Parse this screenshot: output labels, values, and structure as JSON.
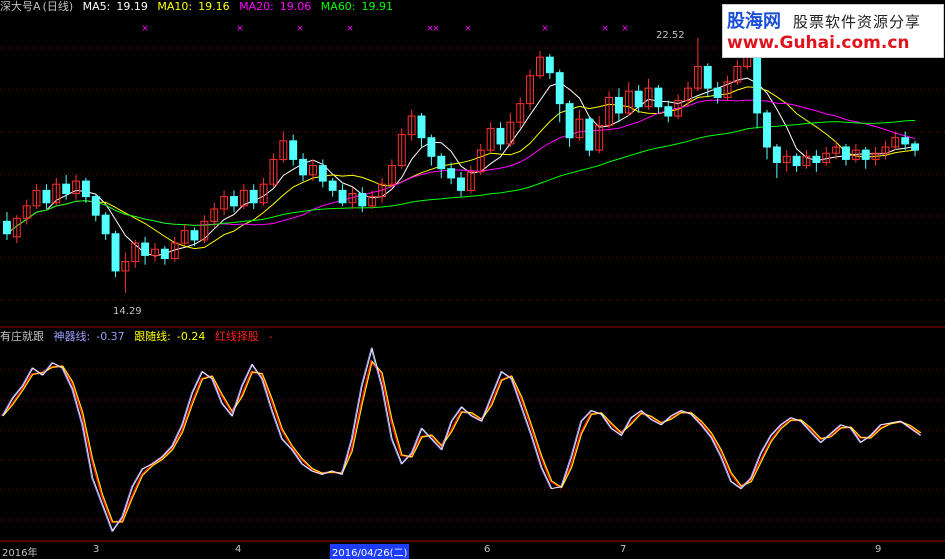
{
  "header": {
    "stock_name": "深大号A",
    "period": "(日线)",
    "ma5": {
      "label": "MA5:",
      "value": "19.19",
      "color": "#ffffff"
    },
    "ma10": {
      "label": "MA10:",
      "value": "19.16",
      "color": "#ffff00"
    },
    "ma20": {
      "label": "MA20:",
      "value": "19.06",
      "color": "#ff00ff"
    },
    "ma60": {
      "label": "MA60:",
      "value": "19.91",
      "color": "#00ff00"
    }
  },
  "indicator": {
    "name": "有庄就跟",
    "line1": {
      "label": "神器线:",
      "value": "-0.37",
      "color": "#9b9bff"
    },
    "line2": {
      "label": "跟随线:",
      "value": "-0.24",
      "color": "#ffff00"
    },
    "line3": {
      "label": "红线择股",
      "value": "-",
      "color": "#ff2020"
    }
  },
  "annotations": {
    "high": "22.52",
    "low": "14.29"
  },
  "logo": {
    "title": "股海网",
    "subtitle": "股票软件资源分享",
    "url": "www.Guhai.com.cn"
  },
  "axis": {
    "left": "2016年",
    "date_highlight": "2016/04/26(二)",
    "ticks": [
      "3",
      "4",
      "6",
      "7",
      "9"
    ]
  },
  "colors": {
    "up": "#ff3030",
    "down": "#54ffff",
    "grid": "#800000",
    "bg": "#000000"
  },
  "chart_data": {
    "type": "candlestick",
    "price_range": [
      14.29,
      22.52
    ],
    "series": [
      {
        "name": "MA5",
        "color": "#ffffff"
      },
      {
        "name": "MA10",
        "color": "#ffff00"
      },
      {
        "name": "MA20",
        "color": "#ff00ff"
      },
      {
        "name": "MA60",
        "color": "#00ff00"
      }
    ],
    "candles": [
      [
        16.6,
        16.2,
        16.9,
        16.0
      ],
      [
        16.1,
        16.7,
        16.8,
        15.9
      ],
      [
        16.7,
        17.1,
        17.3,
        16.5
      ],
      [
        17.1,
        17.6,
        17.8,
        17.0
      ],
      [
        17.6,
        17.2,
        17.8,
        17.0
      ],
      [
        17.2,
        17.8,
        18.0,
        17.1
      ],
      [
        17.8,
        17.5,
        18.1,
        17.3
      ],
      [
        17.5,
        17.9,
        18.1,
        17.3
      ],
      [
        17.9,
        17.4,
        18.0,
        17.2
      ],
      [
        17.4,
        16.8,
        17.5,
        16.6
      ],
      [
        16.8,
        16.2,
        16.9,
        16.0
      ],
      [
        16.2,
        15.0,
        16.3,
        14.8
      ],
      [
        15.0,
        15.3,
        15.6,
        14.29
      ],
      [
        15.3,
        15.9,
        16.0,
        15.1
      ],
      [
        15.9,
        15.5,
        16.1,
        15.2
      ],
      [
        15.5,
        15.7,
        15.9,
        15.3
      ],
      [
        15.7,
        15.4,
        15.8,
        15.2
      ],
      [
        15.4,
        15.9,
        16.1,
        15.3
      ],
      [
        15.9,
        16.3,
        16.5,
        15.8
      ],
      [
        16.3,
        16.0,
        16.4,
        15.8
      ],
      [
        16.0,
        16.6,
        16.8,
        15.9
      ],
      [
        16.6,
        17.0,
        17.2,
        16.4
      ],
      [
        17.0,
        17.4,
        17.6,
        16.8
      ],
      [
        17.4,
        17.1,
        17.6,
        16.9
      ],
      [
        17.1,
        17.6,
        17.8,
        17.0
      ],
      [
        17.6,
        17.2,
        17.8,
        17.0
      ],
      [
        17.2,
        17.8,
        18.0,
        17.1
      ],
      [
        17.8,
        18.6,
        18.8,
        17.7
      ],
      [
        18.6,
        19.2,
        19.5,
        18.5
      ],
      [
        19.2,
        18.6,
        19.4,
        18.4
      ],
      [
        18.6,
        18.1,
        18.8,
        17.9
      ],
      [
        18.1,
        18.4,
        18.6,
        17.9
      ],
      [
        18.4,
        17.9,
        18.6,
        17.7
      ],
      [
        17.9,
        17.6,
        18.0,
        17.4
      ],
      [
        17.6,
        17.2,
        17.8,
        17.1
      ],
      [
        17.2,
        17.5,
        17.7,
        17.0
      ],
      [
        17.5,
        17.1,
        17.7,
        16.9
      ],
      [
        17.1,
        17.4,
        17.6,
        17.0
      ],
      [
        17.4,
        17.8,
        18.0,
        17.2
      ],
      [
        17.8,
        18.4,
        18.6,
        17.7
      ],
      [
        18.4,
        19.4,
        19.6,
        18.3
      ],
      [
        19.4,
        20.0,
        20.2,
        19.2
      ],
      [
        20.0,
        19.3,
        20.1,
        19.0
      ],
      [
        19.3,
        18.7,
        19.4,
        18.4
      ],
      [
        18.7,
        18.3,
        18.8,
        18.0
      ],
      [
        18.3,
        18.0,
        18.5,
        17.8
      ],
      [
        18.0,
        17.6,
        18.2,
        17.4
      ],
      [
        17.6,
        18.2,
        18.4,
        17.5
      ],
      [
        18.2,
        18.9,
        19.1,
        18.1
      ],
      [
        18.9,
        19.6,
        19.8,
        18.8
      ],
      [
        19.6,
        19.1,
        19.8,
        18.9
      ],
      [
        19.1,
        19.8,
        20.1,
        19.0
      ],
      [
        19.8,
        20.4,
        20.6,
        19.6
      ],
      [
        20.4,
        21.3,
        21.5,
        20.2
      ],
      [
        21.3,
        21.9,
        22.1,
        21.2
      ],
      [
        21.9,
        21.4,
        22.0,
        21.2
      ],
      [
        21.4,
        20.4,
        21.5,
        19.8
      ],
      [
        20.4,
        19.3,
        20.5,
        19.0
      ],
      [
        19.3,
        19.9,
        20.2,
        19.2
      ],
      [
        19.9,
        18.9,
        20.0,
        18.7
      ],
      [
        18.9,
        19.7,
        20.0,
        18.8
      ],
      [
        19.7,
        20.6,
        20.8,
        19.6
      ],
      [
        20.6,
        20.1,
        20.9,
        19.8
      ],
      [
        20.1,
        20.8,
        21.1,
        20.0
      ],
      [
        20.8,
        20.3,
        21.0,
        20.1
      ],
      [
        20.3,
        20.9,
        21.2,
        20.2
      ],
      [
        20.9,
        20.3,
        21.0,
        20.1
      ],
      [
        20.3,
        20.0,
        20.5,
        19.8
      ],
      [
        20.0,
        20.5,
        20.7,
        19.9
      ],
      [
        20.5,
        20.9,
        21.1,
        20.3
      ],
      [
        20.9,
        21.6,
        22.52,
        20.8
      ],
      [
        21.6,
        20.9,
        21.7,
        20.6
      ],
      [
        20.9,
        20.6,
        21.1,
        20.4
      ],
      [
        20.6,
        21.1,
        21.3,
        20.5
      ],
      [
        21.1,
        21.6,
        21.8,
        21.0
      ],
      [
        21.6,
        21.9,
        22.1,
        21.5
      ],
      [
        21.9,
        20.1,
        22.0,
        19.6
      ],
      [
        20.1,
        19.0,
        20.2,
        18.6
      ],
      [
        19.0,
        18.5,
        19.1,
        18.0
      ],
      [
        18.5,
        18.7,
        18.9,
        18.2
      ],
      [
        18.7,
        18.4,
        18.8,
        18.2
      ],
      [
        18.4,
        18.7,
        18.9,
        18.3
      ],
      [
        18.7,
        18.5,
        18.9,
        18.2
      ],
      [
        18.5,
        18.8,
        19.0,
        18.4
      ],
      [
        18.8,
        19.0,
        19.2,
        18.6
      ],
      [
        19.0,
        18.6,
        19.1,
        18.4
      ],
      [
        18.6,
        18.9,
        19.1,
        18.5
      ],
      [
        18.9,
        18.6,
        19.0,
        18.3
      ],
      [
        18.6,
        18.8,
        19.0,
        18.4
      ],
      [
        18.8,
        19.0,
        19.2,
        18.6
      ],
      [
        19.0,
        19.3,
        19.5,
        18.9
      ],
      [
        19.3,
        19.1,
        19.5,
        18.9
      ],
      [
        19.1,
        18.9,
        19.2,
        18.7
      ]
    ],
    "indicator_points": [
      0.45,
      0.55,
      0.62,
      0.72,
      0.68,
      0.75,
      0.72,
      0.6,
      0.4,
      0.1,
      -0.05,
      -0.2,
      -0.12,
      0.05,
      0.15,
      0.18,
      0.22,
      0.28,
      0.4,
      0.58,
      0.7,
      0.66,
      0.52,
      0.45,
      0.62,
      0.74,
      0.66,
      0.48,
      0.32,
      0.26,
      0.18,
      0.14,
      0.12,
      0.14,
      0.12,
      0.32,
      0.62,
      0.83,
      0.62,
      0.32,
      0.18,
      0.24,
      0.38,
      0.32,
      0.26,
      0.42,
      0.5,
      0.45,
      0.42,
      0.56,
      0.7,
      0.66,
      0.5,
      0.34,
      0.16,
      0.04,
      0.05,
      0.22,
      0.42,
      0.48,
      0.46,
      0.38,
      0.34,
      0.44,
      0.48,
      0.43,
      0.4,
      0.45,
      0.48,
      0.46,
      0.4,
      0.33,
      0.22,
      0.08,
      0.04,
      0.1,
      0.24,
      0.34,
      0.4,
      0.44,
      0.42,
      0.36,
      0.3,
      0.35,
      0.4,
      0.38,
      0.3,
      0.34,
      0.4,
      0.41,
      0.42,
      0.38,
      0.34
    ]
  }
}
